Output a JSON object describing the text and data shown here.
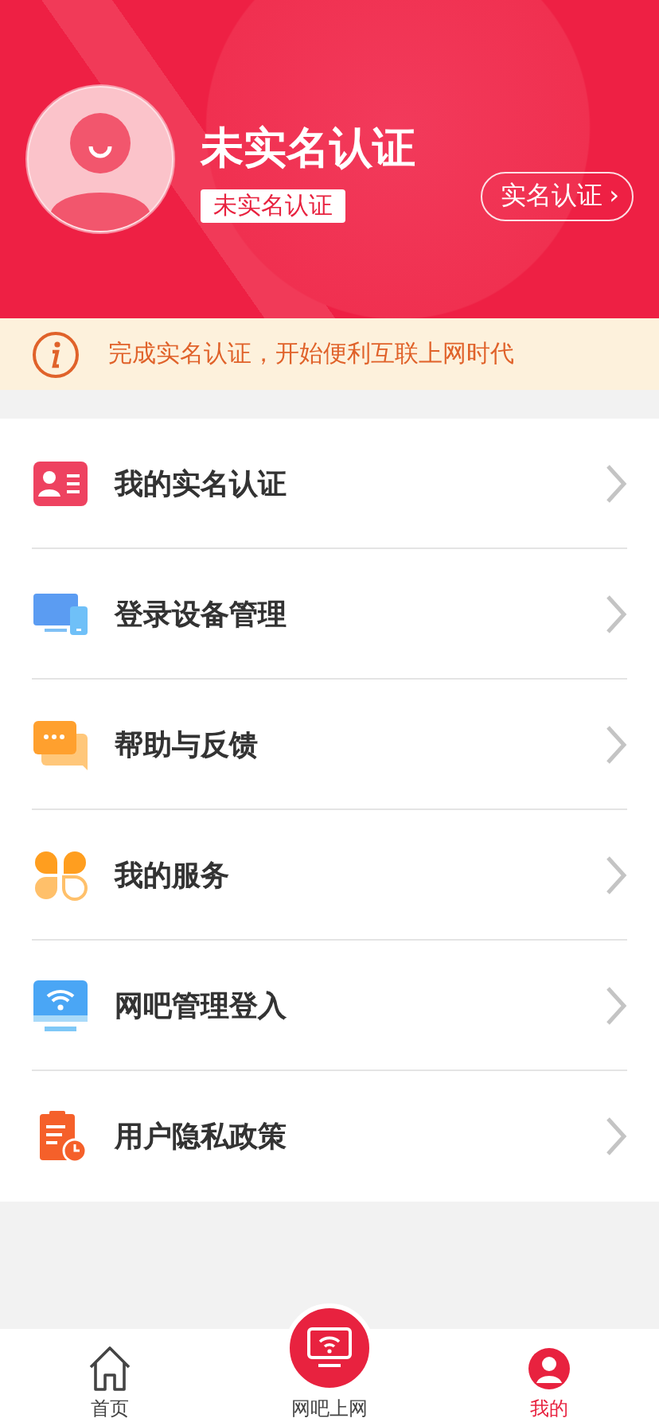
{
  "profile": {
    "name": "未实名认证",
    "badge": "未实名认证",
    "verify_button": "实名认证",
    "verify_arrow": "›"
  },
  "notice": {
    "text": "完成实名认证，开始便利互联上网时代"
  },
  "menu": [
    {
      "kind": "id-card",
      "label": "我的实名认证"
    },
    {
      "kind": "devices",
      "label": "登录设备管理"
    },
    {
      "kind": "feedback",
      "label": "帮助与反馈"
    },
    {
      "kind": "services",
      "label": "我的服务"
    },
    {
      "kind": "wifi-monitor",
      "label": "网吧管理登入"
    },
    {
      "kind": "policy",
      "label": "用户隐私政策"
    }
  ],
  "tabbar": [
    {
      "kind": "home",
      "label": "首页",
      "selected": false
    },
    {
      "kind": "netcafe",
      "label": "网吧上网",
      "selected": false
    },
    {
      "kind": "me",
      "label": "我的",
      "selected": true
    }
  ]
}
